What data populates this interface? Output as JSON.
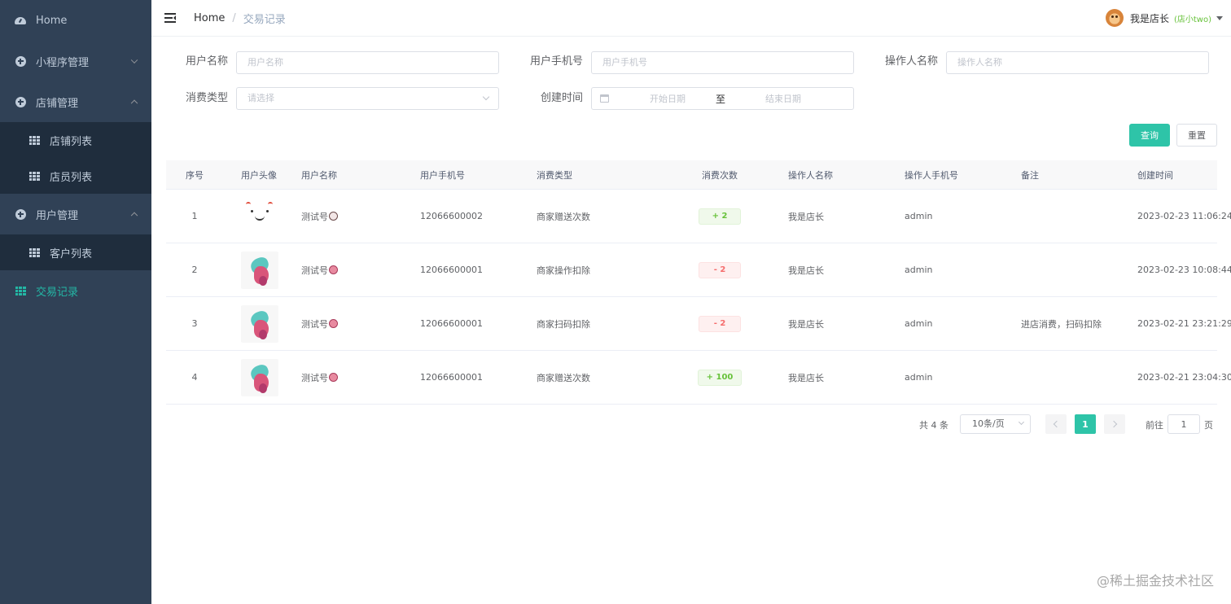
{
  "sidebar": {
    "items": [
      {
        "label": "Home",
        "icon": "dashboard-icon"
      },
      {
        "label": "小程序管理",
        "icon": "circle-plus-icon"
      },
      {
        "label": "店铺管理",
        "icon": "circle-plus-icon"
      },
      {
        "label": "店铺列表",
        "icon": "table-icon"
      },
      {
        "label": "店员列表",
        "icon": "table-icon"
      },
      {
        "label": "用户管理",
        "icon": "circle-plus-icon"
      },
      {
        "label": "客户列表",
        "icon": "table-icon"
      },
      {
        "label": "交易记录",
        "icon": "table-icon"
      }
    ],
    "active_color": "#23b7a5",
    "bg_color": "#304156"
  },
  "header": {
    "breadcrumb_home": "Home",
    "breadcrumb_sep": "/",
    "breadcrumb_current": "交易记录",
    "username": "我是店长",
    "role": "(店小two)"
  },
  "filters": {
    "user_name_label": "用户名称",
    "user_name_placeholder": "用户名称",
    "user_phone_label": "用户手机号",
    "user_phone_placeholder": "用户手机号",
    "operator_name_label": "操作人名称",
    "operator_name_placeholder": "操作人名称",
    "type_label": "消费类型",
    "type_placeholder": "请选择",
    "time_label": "创建时间",
    "start_placeholder": "开始日期",
    "range_sep": "至",
    "end_placeholder": "结束日期",
    "search_button": "查询",
    "reset_button": "重置"
  },
  "table": {
    "columns": [
      "序号",
      "用户头像",
      "用户名称",
      "用户手机号",
      "消费类型",
      "消费次数",
      "操作人名称",
      "操作人手机号",
      "备注",
      "创建时间"
    ],
    "rows": [
      {
        "idx": "1",
        "name": "测试号",
        "phone": "12066600002",
        "type": "商家赠送次数",
        "count": "+ 2",
        "op_name": "我是店长",
        "op_phone": "admin",
        "note": "",
        "time": "2023-02-23 11:06:24"
      },
      {
        "idx": "2",
        "name": "测试号",
        "phone": "12066600001",
        "type": "商家操作扣除",
        "count": "- 2",
        "op_name": "我是店长",
        "op_phone": "admin",
        "note": "",
        "time": "2023-02-23 10:08:44"
      },
      {
        "idx": "3",
        "name": "测试号",
        "phone": "12066600001",
        "type": "商家扫码扣除",
        "count": "- 2",
        "op_name": "我是店长",
        "op_phone": "admin",
        "note": "进店消费，扫码扣除",
        "time": "2023-02-21 23:21:29"
      },
      {
        "idx": "4",
        "name": "测试号",
        "phone": "12066600001",
        "type": "商家赠送次数",
        "count": "+ 100",
        "op_name": "我是店长",
        "op_phone": "admin",
        "note": "",
        "time": "2023-02-21 23:04:30"
      }
    ]
  },
  "pagination": {
    "total": "共 4 条",
    "page_size": "10条/页",
    "current_page": "1",
    "goto_label": "前往",
    "goto_value": "1",
    "page_suffix": "页"
  },
  "watermark": "@稀土掘金技术社区",
  "colors": {
    "primary": "#2ec4a8",
    "plus": "#67c23a",
    "minus": "#f56c6c"
  }
}
